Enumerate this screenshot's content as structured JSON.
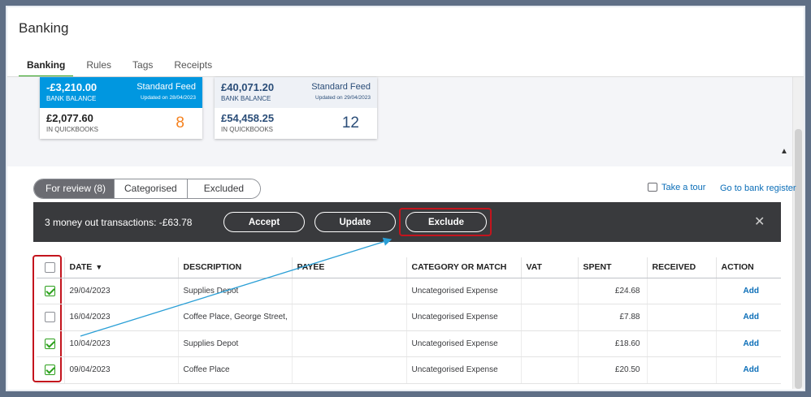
{
  "page": {
    "title": "Banking"
  },
  "tabs": [
    "Banking",
    "Rules",
    "Tags",
    "Receipts"
  ],
  "accounts": [
    {
      "bank_amount": "-£3,210.00",
      "bank_label": "BANK BALANCE",
      "feed": "Standard Feed",
      "updated": "Updated on 28/04/2023",
      "qb_amount": "£2,077.60",
      "qb_label": "IN QUICKBOOKS",
      "count": "8"
    },
    {
      "bank_amount": "£40,071.20",
      "bank_label": "BANK BALANCE",
      "feed": "Standard Feed",
      "updated": "Updated on 29/04/2023",
      "qb_amount": "£54,458.25",
      "qb_label": "IN QUICKBOOKS",
      "count": "12"
    }
  ],
  "review_tabs": [
    "For review (8)",
    "Categorised",
    "Excluded"
  ],
  "links": {
    "tour": "Take a tour",
    "register": "Go to bank register"
  },
  "action_bar": {
    "text": "3 money out transactions: -£63.78",
    "accept": "Accept",
    "update": "Update",
    "exclude": "Exclude",
    "close": "✕"
  },
  "table": {
    "headers": [
      "DATE",
      "DESCRIPTION",
      "PAYEE",
      "CATEGORY OR MATCH",
      "VAT",
      "SPENT",
      "RECEIVED",
      "ACTION"
    ],
    "sort_indicator": "▼",
    "rows": [
      {
        "checked": true,
        "date": "29/04/2023",
        "description": "Supplies Depot",
        "payee": "",
        "category": "Uncategorised Expense",
        "vat": "",
        "spent": "£24.68",
        "received": "",
        "action": "Add"
      },
      {
        "checked": false,
        "date": "16/04/2023",
        "description": "Coffee Place, George Street,",
        "payee": "",
        "category": "Uncategorised Expense",
        "vat": "",
        "spent": "£7.88",
        "received": "",
        "action": "Add"
      },
      {
        "checked": true,
        "date": "10/04/2023",
        "description": "Supplies Depot",
        "payee": "",
        "category": "Uncategorised Expense",
        "vat": "",
        "spent": "£18.60",
        "received": "",
        "action": "Add"
      },
      {
        "checked": true,
        "date": "09/04/2023",
        "description": "Coffee Place",
        "payee": "",
        "category": "Uncategorised Expense",
        "vat": "",
        "spent": "£20.50",
        "received": "",
        "action": "Add"
      }
    ]
  },
  "colors": {
    "accent_green": "#2ca01c",
    "feed_blue": "#0097e0",
    "count_orange": "#f58220",
    "annotation_red": "#c4141d",
    "arrow_blue": "#2a9fd6"
  }
}
